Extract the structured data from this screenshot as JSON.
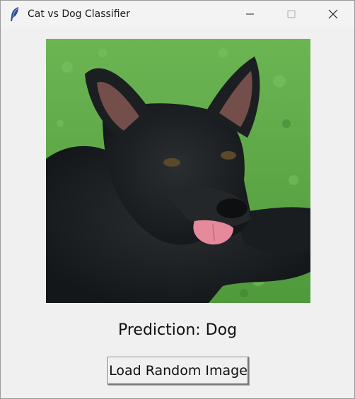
{
  "window": {
    "title": "Cat vs Dog Classifier",
    "controls": {
      "minimize_icon": "minimize-icon",
      "maximize_icon": "maximize-icon",
      "close_icon": "close-icon"
    }
  },
  "image": {
    "subject": "dog-photo",
    "colors": {
      "grass": "#5aa744",
      "fur": "#1c1f22",
      "tongue": "#e58a9a"
    }
  },
  "prediction": {
    "text": "Prediction: Dog"
  },
  "actions": {
    "load_label": "Load Random Image"
  }
}
